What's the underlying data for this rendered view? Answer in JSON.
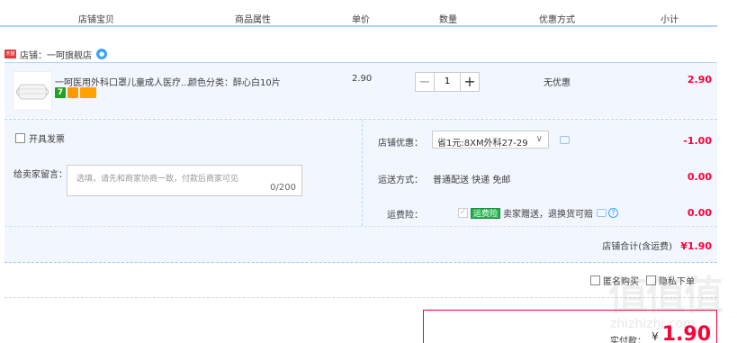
{
  "table_header": {
    "shop_item": "店铺宝贝",
    "attributes": "商品属性",
    "unit_price": "单价",
    "quantity": "数量",
    "discount": "优惠方式",
    "subtotal": "小计"
  },
  "shop": {
    "badge": "天猫",
    "name": "店铺：一呵旗舰店"
  },
  "item": {
    "title": "一呵医用外科口罩儿童成人医疗...",
    "tag_green_text": "7",
    "attribute": "颜色分类：醉心白10片",
    "price": "2.90",
    "qty": "1",
    "qty_minus": "−",
    "qty_plus": "+",
    "discount": "无优惠",
    "subtotal": "2.90"
  },
  "options": {
    "invoice_label": "开具发票",
    "message_label": "给卖家留言：",
    "message_placeholder": "选填，请先和商家协商一致，付款后商家可见",
    "message_count": "0/200",
    "shop_coupon_label": "店铺优惠：",
    "shop_coupon_value": "省1元:8XM外科27-29",
    "shop_coupon_arrow": "∨",
    "shop_coupon_amount": "-1.00",
    "shipping_label": "运送方式：",
    "shipping_value": "普通配送 快递 免邮",
    "shipping_amount": "0.00",
    "insurance_label": "运费险：",
    "insurance_tag": "运费险",
    "insurance_text": "卖家赠送，退换货可赔",
    "insurance_help": "?",
    "insurance_amount": "0.00"
  },
  "shop_total": {
    "label": "店铺合计(含运费)",
    "amount": "¥1.90"
  },
  "bottom": {
    "anonymous_label": "匿名购买",
    "secret_label": "隐私下单"
  },
  "payment": {
    "label": "实付款：",
    "currency": "¥",
    "amount": "1.90"
  },
  "watermark": {
    "text": "值值值",
    "url": "zhizhizhi.com"
  },
  "colors": {
    "accent_red": "#ff0036",
    "header_border": "#b2d1ff",
    "row_bg": "#f2f7ff",
    "insurance_green": "#22b14c"
  }
}
